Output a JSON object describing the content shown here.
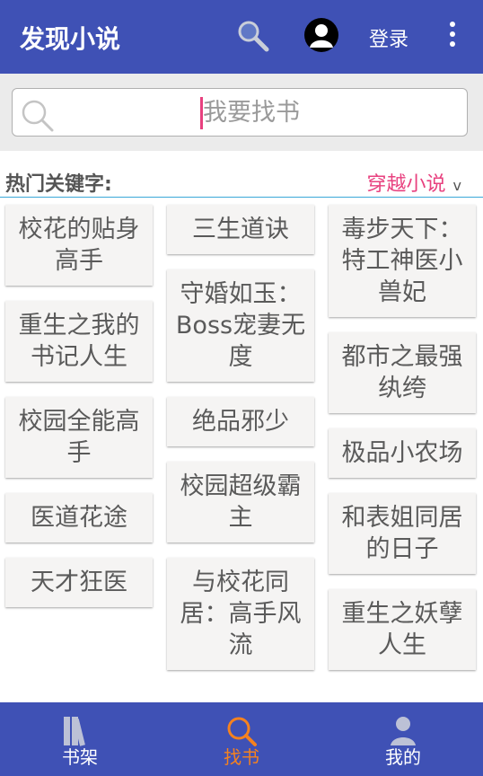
{
  "app_bar": {
    "title": "发现小说",
    "login_label": "登录"
  },
  "search": {
    "placeholder": "我要找书",
    "value": ""
  },
  "hot": {
    "label": "热门关键字:",
    "category": "穿越小说",
    "chevron": "v",
    "columns": [
      [
        "校花的贴身高手",
        "重生之我的书记人生",
        "校园全能高手",
        "医道花途",
        "天才狂医"
      ],
      [
        "三生道诀",
        "守婚如玉：Boss宠妻无度",
        "绝品邪少",
        "校园超级霸主",
        "与校花同居：高手风流"
      ],
      [
        "毒步天下：特工神医小兽妃",
        "都市之最强纨绔",
        "极品小农场",
        "和表姐同居的日子",
        "重生之妖孽人生"
      ]
    ]
  },
  "nav": {
    "items": [
      {
        "label": "书架",
        "icon": "bookshelf-icon",
        "active": false
      },
      {
        "label": "找书",
        "icon": "find-book-icon",
        "active": true
      },
      {
        "label": "我的",
        "icon": "profile-icon",
        "active": false
      }
    ]
  },
  "colors": {
    "primary": "#3f51b5",
    "accent": "#e8417f",
    "nav_active": "#f5821f"
  }
}
